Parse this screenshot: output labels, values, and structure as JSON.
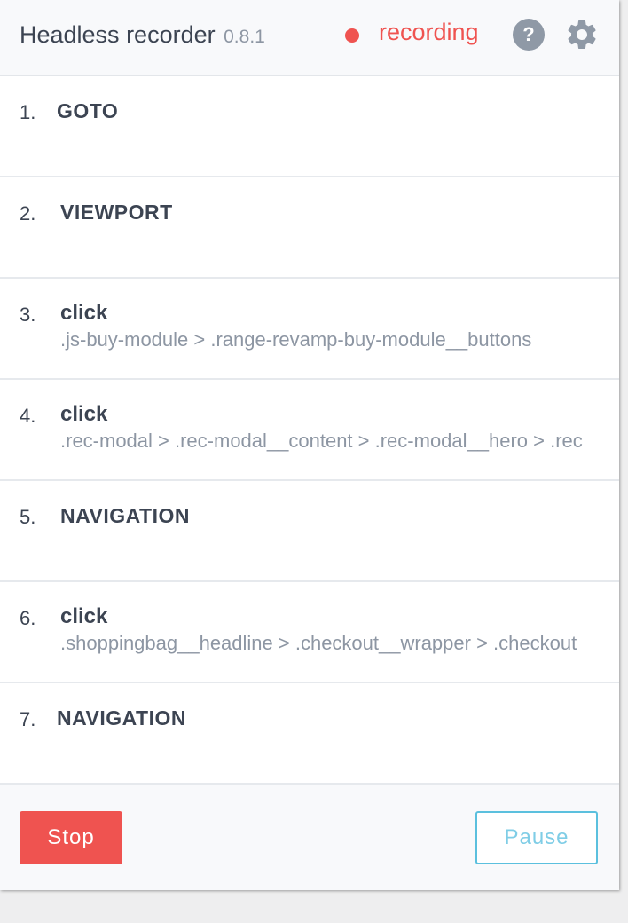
{
  "header": {
    "title": "Headless recorder",
    "version": "0.8.1",
    "status": "recording"
  },
  "events": [
    {
      "num": "1.",
      "action": "GOTO",
      "selector": ""
    },
    {
      "num": "2.",
      "action": "VIEWPORT",
      "selector": ""
    },
    {
      "num": "3.",
      "action": "click",
      "selector": ".js-buy-module > .range-revamp-buy-module__buttons"
    },
    {
      "num": "4.",
      "action": "click",
      "selector": ".rec-modal > .rec-modal__content > .rec-modal__hero > .rec"
    },
    {
      "num": "5.",
      "action": "NAVIGATION",
      "selector": ""
    },
    {
      "num": "6.",
      "action": "click",
      "selector": ".shoppingbag__headline > .checkout__wrapper > .checkout"
    },
    {
      "num": "7.",
      "action": "NAVIGATION",
      "selector": ""
    }
  ],
  "footer": {
    "stop_label": "Stop",
    "pause_label": "Pause"
  },
  "colors": {
    "accent_red": "#ef5350",
    "accent_blue": "#5bc0de",
    "text_dark": "#3c4452",
    "text_muted": "#8d96a3"
  },
  "icons": {
    "status": "recording-dot-icon",
    "help": "help-icon",
    "settings": "gear-icon"
  }
}
